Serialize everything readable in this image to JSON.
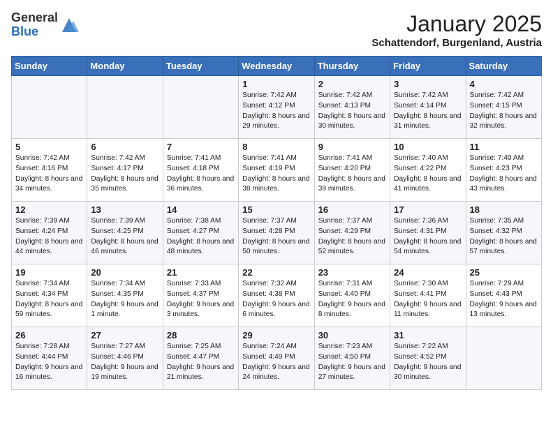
{
  "logo": {
    "general": "General",
    "blue": "Blue"
  },
  "header": {
    "month": "January 2025",
    "location": "Schattendorf, Burgenland, Austria"
  },
  "days_of_week": [
    "Sunday",
    "Monday",
    "Tuesday",
    "Wednesday",
    "Thursday",
    "Friday",
    "Saturday"
  ],
  "weeks": [
    [
      {
        "day": "",
        "info": ""
      },
      {
        "day": "",
        "info": ""
      },
      {
        "day": "",
        "info": ""
      },
      {
        "day": "1",
        "info": "Sunrise: 7:42 AM\nSunset: 4:12 PM\nDaylight: 8 hours and 29 minutes."
      },
      {
        "day": "2",
        "info": "Sunrise: 7:42 AM\nSunset: 4:13 PM\nDaylight: 8 hours and 30 minutes."
      },
      {
        "day": "3",
        "info": "Sunrise: 7:42 AM\nSunset: 4:14 PM\nDaylight: 8 hours and 31 minutes."
      },
      {
        "day": "4",
        "info": "Sunrise: 7:42 AM\nSunset: 4:15 PM\nDaylight: 8 hours and 32 minutes."
      }
    ],
    [
      {
        "day": "5",
        "info": "Sunrise: 7:42 AM\nSunset: 4:16 PM\nDaylight: 8 hours and 34 minutes."
      },
      {
        "day": "6",
        "info": "Sunrise: 7:42 AM\nSunset: 4:17 PM\nDaylight: 8 hours and 35 minutes."
      },
      {
        "day": "7",
        "info": "Sunrise: 7:41 AM\nSunset: 4:18 PM\nDaylight: 8 hours and 36 minutes."
      },
      {
        "day": "8",
        "info": "Sunrise: 7:41 AM\nSunset: 4:19 PM\nDaylight: 8 hours and 38 minutes."
      },
      {
        "day": "9",
        "info": "Sunrise: 7:41 AM\nSunset: 4:20 PM\nDaylight: 8 hours and 39 minutes."
      },
      {
        "day": "10",
        "info": "Sunrise: 7:40 AM\nSunset: 4:22 PM\nDaylight: 8 hours and 41 minutes."
      },
      {
        "day": "11",
        "info": "Sunrise: 7:40 AM\nSunset: 4:23 PM\nDaylight: 8 hours and 43 minutes."
      }
    ],
    [
      {
        "day": "12",
        "info": "Sunrise: 7:39 AM\nSunset: 4:24 PM\nDaylight: 8 hours and 44 minutes."
      },
      {
        "day": "13",
        "info": "Sunrise: 7:39 AM\nSunset: 4:25 PM\nDaylight: 8 hours and 46 minutes."
      },
      {
        "day": "14",
        "info": "Sunrise: 7:38 AM\nSunset: 4:27 PM\nDaylight: 8 hours and 48 minutes."
      },
      {
        "day": "15",
        "info": "Sunrise: 7:37 AM\nSunset: 4:28 PM\nDaylight: 8 hours and 50 minutes."
      },
      {
        "day": "16",
        "info": "Sunrise: 7:37 AM\nSunset: 4:29 PM\nDaylight: 8 hours and 52 minutes."
      },
      {
        "day": "17",
        "info": "Sunrise: 7:36 AM\nSunset: 4:31 PM\nDaylight: 8 hours and 54 minutes."
      },
      {
        "day": "18",
        "info": "Sunrise: 7:35 AM\nSunset: 4:32 PM\nDaylight: 8 hours and 57 minutes."
      }
    ],
    [
      {
        "day": "19",
        "info": "Sunrise: 7:34 AM\nSunset: 4:34 PM\nDaylight: 8 hours and 59 minutes."
      },
      {
        "day": "20",
        "info": "Sunrise: 7:34 AM\nSunset: 4:35 PM\nDaylight: 9 hours and 1 minute."
      },
      {
        "day": "21",
        "info": "Sunrise: 7:33 AM\nSunset: 4:37 PM\nDaylight: 9 hours and 3 minutes."
      },
      {
        "day": "22",
        "info": "Sunrise: 7:32 AM\nSunset: 4:38 PM\nDaylight: 9 hours and 6 minutes."
      },
      {
        "day": "23",
        "info": "Sunrise: 7:31 AM\nSunset: 4:40 PM\nDaylight: 9 hours and 8 minutes."
      },
      {
        "day": "24",
        "info": "Sunrise: 7:30 AM\nSunset: 4:41 PM\nDaylight: 9 hours and 11 minutes."
      },
      {
        "day": "25",
        "info": "Sunrise: 7:29 AM\nSunset: 4:43 PM\nDaylight: 9 hours and 13 minutes."
      }
    ],
    [
      {
        "day": "26",
        "info": "Sunrise: 7:28 AM\nSunset: 4:44 PM\nDaylight: 9 hours and 16 minutes."
      },
      {
        "day": "27",
        "info": "Sunrise: 7:27 AM\nSunset: 4:46 PM\nDaylight: 9 hours and 19 minutes."
      },
      {
        "day": "28",
        "info": "Sunrise: 7:25 AM\nSunset: 4:47 PM\nDaylight: 9 hours and 21 minutes."
      },
      {
        "day": "29",
        "info": "Sunrise: 7:24 AM\nSunset: 4:49 PM\nDaylight: 9 hours and 24 minutes."
      },
      {
        "day": "30",
        "info": "Sunrise: 7:23 AM\nSunset: 4:50 PM\nDaylight: 9 hours and 27 minutes."
      },
      {
        "day": "31",
        "info": "Sunrise: 7:22 AM\nSunset: 4:52 PM\nDaylight: 9 hours and 30 minutes."
      },
      {
        "day": "",
        "info": ""
      }
    ]
  ]
}
